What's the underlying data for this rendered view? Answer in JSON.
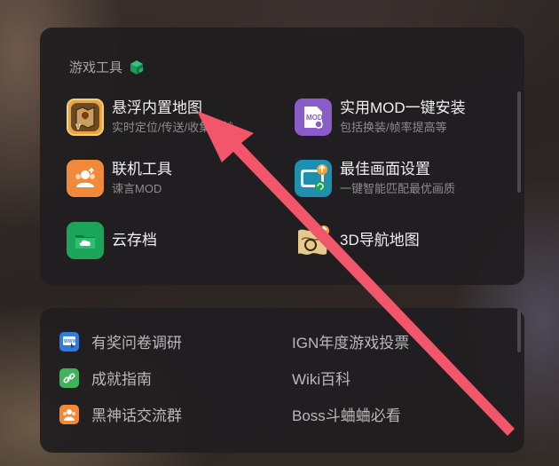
{
  "tools_section": {
    "title": "游戏工具",
    "items": [
      {
        "title": "悬浮内置地图",
        "subtitle": "实时定位/传送/收集成就",
        "icon": "floating-map-icon"
      },
      {
        "title": "实用MOD一键安装",
        "subtitle": "包括换装/帧率提高等",
        "icon": "mod-install-icon"
      },
      {
        "title": "联机工具",
        "subtitle": "谏言MOD",
        "icon": "multiplayer-icon"
      },
      {
        "title": "最佳画面设置",
        "subtitle": "一键智能匹配最优画质",
        "icon": "graphics-settings-icon"
      },
      {
        "title": "云存档",
        "subtitle": "",
        "icon": "cloud-save-icon"
      },
      {
        "title": "3D导航地图",
        "subtitle": "",
        "icon": "map-3d-icon"
      }
    ]
  },
  "links_section": {
    "left": [
      {
        "label": "有奖问卷调研",
        "icon": "survey-icon"
      },
      {
        "label": "成就指南",
        "icon": "link-icon"
      },
      {
        "label": "黑神话交流群",
        "icon": "group-chat-icon"
      }
    ],
    "right": [
      {
        "label": "IGN年度游戏投票"
      },
      {
        "label": "Wiki百科"
      },
      {
        "label": "Boss斗蛐蛐必看"
      }
    ]
  },
  "colors": {
    "accent_green": "#1aa55a",
    "arrow": "#f2566a",
    "mod_purple": "#8a5cc8",
    "multiplayer_orange": "#f08a3a",
    "graphics_teal": "#1f8fb0"
  }
}
